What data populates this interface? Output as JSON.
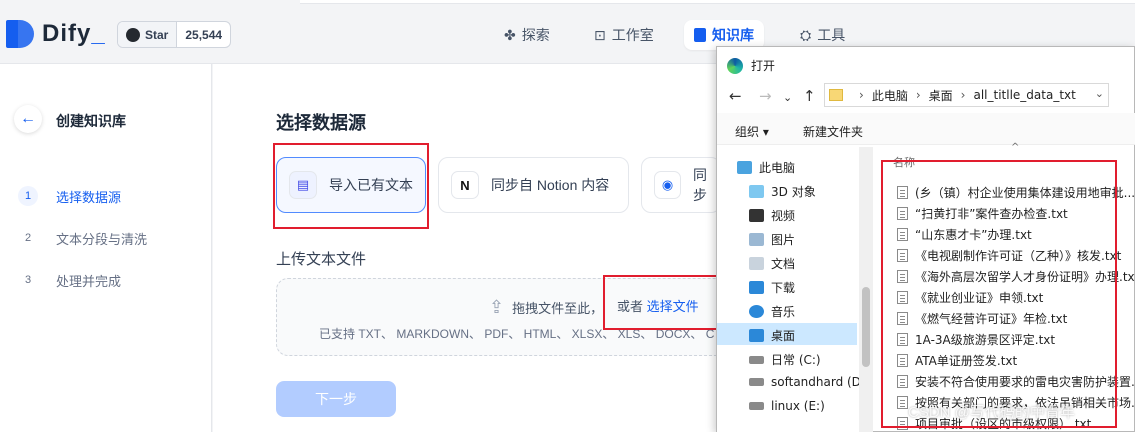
{
  "app": {
    "logo_text": "Dify",
    "star_label": "Star",
    "star_count": "25,544",
    "nav": [
      {
        "label": "探索",
        "icon": "explore-icon"
      },
      {
        "label": "工作室",
        "icon": "studio-icon"
      },
      {
        "label": "知识库",
        "icon": "knowledge-icon"
      },
      {
        "label": "工具",
        "icon": "tools-icon"
      }
    ],
    "accent": "#155eef"
  },
  "sidebar": {
    "title": "创建知识库",
    "steps": [
      {
        "num": "1",
        "label": "选择数据源"
      },
      {
        "num": "2",
        "label": "文本分段与清洗"
      },
      {
        "num": "3",
        "label": "处理并完成"
      }
    ]
  },
  "main": {
    "section_title": "选择数据源",
    "sources": [
      {
        "label": "导入已有文本"
      },
      {
        "label": "同步自 Notion 内容"
      },
      {
        "label": "同步"
      }
    ],
    "upload_title": "上传文本文件",
    "drop_text": "拖拽文件至此，",
    "or_text": "或者",
    "select_file": "选择文件",
    "supported": "已支持 TXT、 MARKDOWN、 PDF、 HTML、 XLSX、 XLS、 DOCX、 C",
    "next_button": "下一步"
  },
  "dialog": {
    "title": "打开",
    "path": [
      "此电脑",
      "桌面",
      "all_titlle_data_txt"
    ],
    "organize": "组织 ▾",
    "new_folder": "新建文件夹",
    "column_name": "名称",
    "tree": [
      {
        "label": "此电脑",
        "icon": "pc-icon",
        "color": "#4aa3df"
      },
      {
        "label": "3D 对象",
        "icon": "3d-objects-icon",
        "color": "#7ec8f0"
      },
      {
        "label": "视频",
        "icon": "video-icon",
        "color": "#333333"
      },
      {
        "label": "图片",
        "icon": "pictures-icon",
        "color": "#9bb8d3"
      },
      {
        "label": "文档",
        "icon": "documents-icon",
        "color": "#c9d3dd"
      },
      {
        "label": "下载",
        "icon": "downloads-icon",
        "color": "#2b88d8"
      },
      {
        "label": "音乐",
        "icon": "music-icon",
        "color": "#2b88d8"
      },
      {
        "label": "桌面",
        "icon": "desktop-icon",
        "color": "#2b88d8"
      },
      {
        "label": "日常 (C:)",
        "icon": "drive-c-icon",
        "color": "#8a8a8a"
      },
      {
        "label": "softandhard (D",
        "icon": "drive-d-icon",
        "color": "#8a8a8a"
      },
      {
        "label": "linux (E:)",
        "icon": "drive-e-icon",
        "color": "#8a8a8a"
      }
    ],
    "files": [
      "(乡（镇）村企业使用集体建设用地审批...",
      "“扫黄打非”案件查办检查.txt",
      "“山东惠才卡”办理.txt",
      "《电视剧制作许可证（乙种）》核发.txt",
      "《海外高层次留学人才身份证明》办理.txt",
      "《就业创业证》申领.txt",
      "《燃气经营许可证》年检.txt",
      "1A-3A级旅游景区评定.txt",
      "ATA单证册签发.txt",
      "安装不符合使用要求的雷电灾害防护装置...",
      "按照有关部门的要求，依法吊销相关市场...",
      "项目审批（设区的市级权限）.txt"
    ]
  },
  "watermark": "CSDN @写代码的中青年",
  "highlight_color": "#e11d2e"
}
